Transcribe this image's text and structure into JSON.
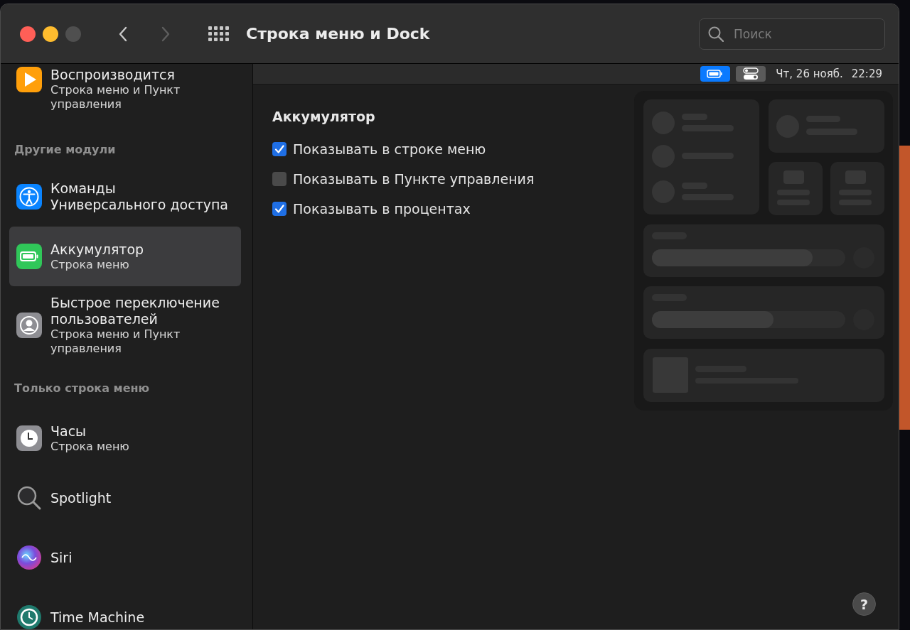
{
  "window": {
    "title": "Строка меню и Dock",
    "back": {
      "disabled": false
    },
    "forward": {
      "disabled": true
    }
  },
  "search": {
    "placeholder": "Поиск"
  },
  "sidebar": {
    "items": [
      {
        "kind": "item",
        "title": "Воспроизводится",
        "subtitle": "Строка меню и Пункт управления",
        "selected": false
      },
      {
        "kind": "header",
        "label": "Другие модули"
      },
      {
        "kind": "item",
        "title": "Команды Универсального доступа",
        "selected": false
      },
      {
        "kind": "item",
        "title": "Аккумулятор",
        "subtitle": "Строка меню",
        "selected": true
      },
      {
        "kind": "item",
        "title": "Быстрое переключение пользователей",
        "subtitle": "Строка меню и Пункт управления",
        "selected": false
      },
      {
        "kind": "header",
        "label": "Только строка меню"
      },
      {
        "kind": "item",
        "title": "Часы",
        "subtitle": "Строка меню",
        "selected": false
      },
      {
        "kind": "item",
        "title": "Spotlight",
        "selected": false
      },
      {
        "kind": "item",
        "title": "Siri",
        "selected": false
      },
      {
        "kind": "item",
        "title": "Time Machine",
        "selected": false
      }
    ]
  },
  "menubar_preview": {
    "status_items": [
      {
        "selected": true
      },
      {
        "selected": false
      }
    ],
    "date": "Чт, 26 нояб.",
    "time": "22:29"
  },
  "settings": {
    "heading": "Аккумулятор",
    "options": [
      {
        "label": "Показывать в строке меню",
        "checked": true
      },
      {
        "label": "Показывать в Пункте управления",
        "checked": false
      },
      {
        "label": "Показывать в процентах",
        "checked": true
      }
    ]
  },
  "help_button": {
    "label": "?"
  }
}
